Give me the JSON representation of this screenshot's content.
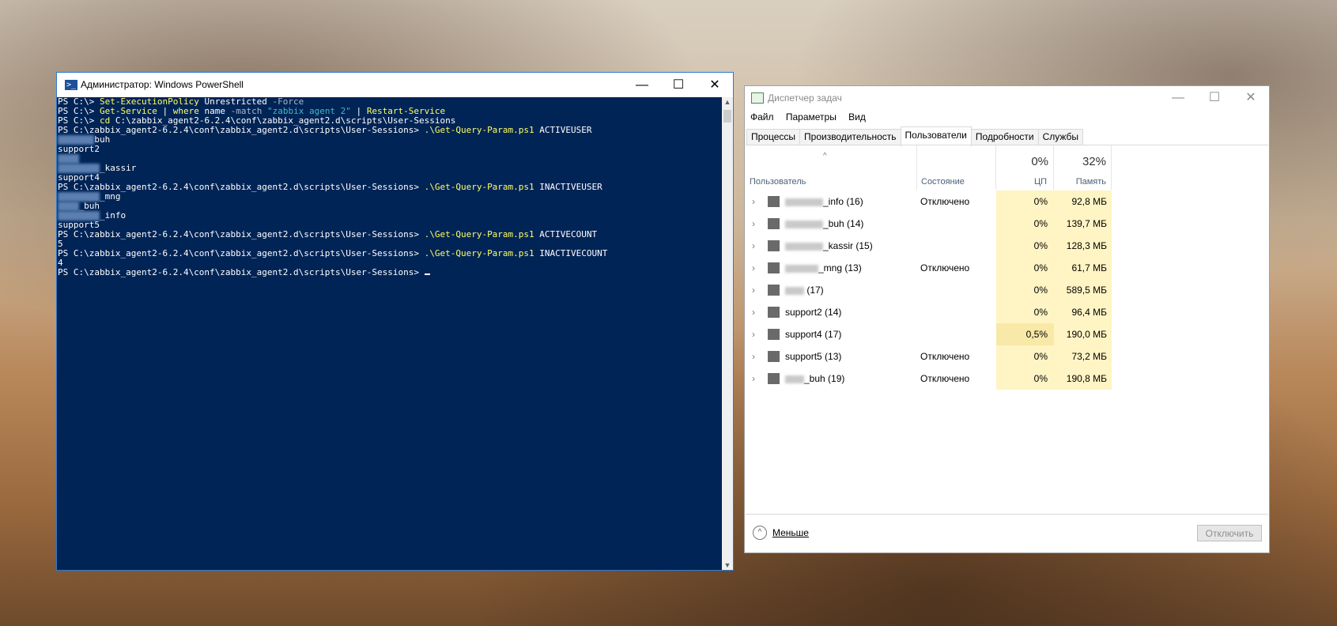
{
  "powershell": {
    "title": "Администратор: Windows PowerShell",
    "lines": [
      {
        "prompt": "PS C:\\> ",
        "parts": [
          [
            "Set-ExecutionPolicy",
            "y"
          ],
          [
            " Unrestricted ",
            "w"
          ],
          [
            "-Force",
            "g"
          ]
        ]
      },
      {
        "prompt": "PS C:\\> ",
        "parts": [
          [
            "Get-Service",
            "y"
          ],
          [
            " | ",
            "w"
          ],
          [
            "where",
            "y"
          ],
          [
            " name ",
            "w"
          ],
          [
            "-match",
            "g"
          ],
          [
            " \"zabbix agent 2\"",
            "t"
          ],
          [
            " | ",
            "w"
          ],
          [
            "Restart-Service",
            "y"
          ]
        ]
      },
      {
        "prompt": "PS C:\\> ",
        "parts": [
          [
            "cd",
            "y"
          ],
          [
            " C:\\zabbix_agent2-6.2.4\\conf\\zabbix_agent2.d\\scripts\\User-Sessions",
            "w"
          ]
        ]
      },
      {
        "prompt": "PS C:\\zabbix_agent2-6.2.4\\conf\\zabbix_agent2.d\\scripts\\User-Sessions> ",
        "parts": [
          [
            ".\\Get-Query-Param.ps1",
            "y"
          ],
          [
            " ACTIVEUSER",
            "w"
          ]
        ]
      },
      {
        "blur": "xxxxxxx",
        "text": "buh"
      },
      {
        "text": "support2"
      },
      {
        "blur": "xxxx",
        "text": ""
      },
      {
        "blur": "xxxxxxxx",
        "text": "_kassir"
      },
      {
        "text": "support4"
      },
      {
        "prompt": "PS C:\\zabbix_agent2-6.2.4\\conf\\zabbix_agent2.d\\scripts\\User-Sessions> ",
        "parts": [
          [
            ".\\Get-Query-Param.ps1",
            "y"
          ],
          [
            " INACTIVEUSER",
            "w"
          ]
        ]
      },
      {
        "blur": "xxxxxxxx",
        "text": "_mng"
      },
      {
        "blur": "xxxx",
        "text": "_buh"
      },
      {
        "blur": "xxxxxxxx",
        "text": "_info"
      },
      {
        "text": "support5"
      },
      {
        "prompt": "PS C:\\zabbix_agent2-6.2.4\\conf\\zabbix_agent2.d\\scripts\\User-Sessions> ",
        "parts": [
          [
            ".\\Get-Query-Param.ps1",
            "y"
          ],
          [
            " ACTIVECOUNT",
            "w"
          ]
        ]
      },
      {
        "text": "5"
      },
      {
        "prompt": "PS C:\\zabbix_agent2-6.2.4\\conf\\zabbix_agent2.d\\scripts\\User-Sessions> ",
        "parts": [
          [
            ".\\Get-Query-Param.ps1",
            "y"
          ],
          [
            " INACTIVECOUNT",
            "w"
          ]
        ]
      },
      {
        "text": "4"
      },
      {
        "prompt": "PS C:\\zabbix_agent2-6.2.4\\conf\\zabbix_agent2.d\\scripts\\User-Sessions> ",
        "parts": [],
        "cursor": true
      }
    ]
  },
  "taskmanager": {
    "title": "Диспетчер задач",
    "menu": [
      "Файл",
      "Параметры",
      "Вид"
    ],
    "tabs": [
      "Процессы",
      "Производительность",
      "Пользователи",
      "Подробности",
      "Службы"
    ],
    "active_tab": "Пользователи",
    "columns": {
      "user": "Пользователь",
      "status": "Состояние",
      "cpu_label": "ЦП",
      "cpu_total": "0%",
      "mem_label": "Память",
      "mem_total": "32%"
    },
    "rows": [
      {
        "blur": "xxxxxxxx",
        "name": "_info (16)",
        "status": "Отключено",
        "cpu": "0%",
        "mem": "92,8 МБ"
      },
      {
        "blur": "xxxxxxxx",
        "name": "_buh (14)",
        "status": "",
        "cpu": "0%",
        "mem": "139,7 МБ"
      },
      {
        "blur": "xxxxxxxx",
        "name": "_kassir (15)",
        "status": "",
        "cpu": "0%",
        "mem": "128,3 МБ"
      },
      {
        "blur": "xxxxxxx",
        "name": "_mng (13)",
        "status": "Отключено",
        "cpu": "0%",
        "mem": "61,7 МБ"
      },
      {
        "blur": "xxxx",
        "name": " (17)",
        "status": "",
        "cpu": "0%",
        "mem": "589,5 МБ"
      },
      {
        "blur": "",
        "name": "support2 (14)",
        "status": "",
        "cpu": "0%",
        "mem": "96,4 МБ"
      },
      {
        "blur": "",
        "name": "support4 (17)",
        "status": "",
        "cpu": "0,5%",
        "mem": "190,0 МБ"
      },
      {
        "blur": "",
        "name": "support5 (13)",
        "status": "Отключено",
        "cpu": "0%",
        "mem": "73,2 МБ"
      },
      {
        "blur": "xxxx",
        "name": "_buh (19)",
        "status": "Отключено",
        "cpu": "0%",
        "mem": "190,8 МБ"
      }
    ],
    "footer": {
      "less_label": "Меньше",
      "disconnect_label": "Отключить"
    }
  },
  "colors": {
    "console_bg": "#012456",
    "console_cmd": "#ffff66",
    "cpu_highlight": "#fff4c4"
  }
}
